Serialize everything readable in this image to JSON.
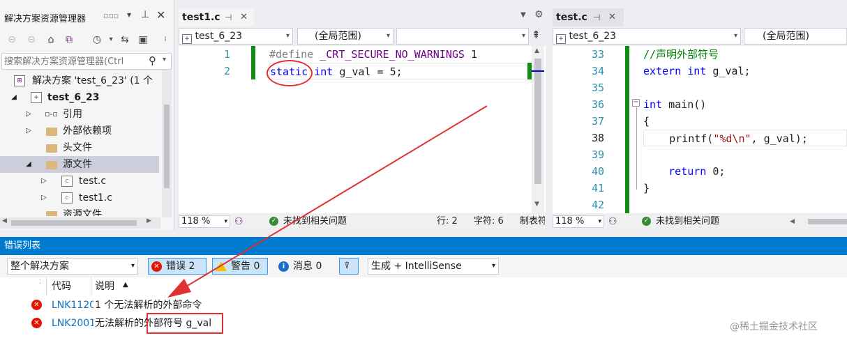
{
  "solution_explorer": {
    "title": "解决方案资源管理器",
    "search_placeholder": "搜索解决方案资源管理器(Ctrl",
    "items": [
      {
        "label": "解决方案 'test_6_23' (1 个"
      },
      {
        "label": "test_6_23"
      },
      {
        "label": "引用"
      },
      {
        "label": "外部依赖项"
      },
      {
        "label": "头文件"
      },
      {
        "label": "源文件"
      },
      {
        "label": "test.c"
      },
      {
        "label": "test1.c"
      },
      {
        "label": "资源文件"
      }
    ]
  },
  "editor_left": {
    "tab": "test1.c",
    "nav_file": "test_6_23",
    "nav_scope": "(全局范围)",
    "nav_member": "",
    "lines": [
      {
        "num": "1",
        "text": "#define _CRT_SECURE_NO_WARNINGS 1"
      },
      {
        "num": "2",
        "text": "static int g_val = 5;"
      }
    ],
    "zoom": "118 %",
    "status": "未找到相关问题",
    "row": "行: 2",
    "col": "字符: 6",
    "tab_mode": "制表符"
  },
  "editor_right": {
    "tab": "test.c",
    "nav_file": "test_6_23",
    "nav_scope": "(全局范围)",
    "lines": [
      {
        "num": "33",
        "text": "//声明外部符号"
      },
      {
        "num": "34",
        "text": "extern int g_val;"
      },
      {
        "num": "35",
        "text": ""
      },
      {
        "num": "36",
        "text": "int main()"
      },
      {
        "num": "37",
        "text": "{"
      },
      {
        "num": "38",
        "text": "    printf(\"%d\\n\", g_val);"
      },
      {
        "num": "39",
        "text": ""
      },
      {
        "num": "40",
        "text": "    return 0;"
      },
      {
        "num": "41",
        "text": "}"
      },
      {
        "num": "42",
        "text": ""
      }
    ],
    "zoom": "118 %",
    "status": "未找到相关问题"
  },
  "error_list": {
    "title": "错误列表",
    "scope": "整个解决方案",
    "errors_label": "错误 2",
    "warnings_label": "警告 0",
    "messages_label": "消息 0",
    "build_filter": "生成 + IntelliSense",
    "col_code": "代码",
    "col_desc": "说明",
    "rows": [
      {
        "code": "LNK1120",
        "desc": "1 个无法解析的外部命令"
      },
      {
        "code": "LNK2001",
        "desc": "无法解析的外部符号 g_val"
      }
    ]
  },
  "watermark": "@稀土掘金技术社区",
  "colors": {
    "accent": "#007acc",
    "gutter_green": "#108c16",
    "annotation_red": "#e03030"
  }
}
